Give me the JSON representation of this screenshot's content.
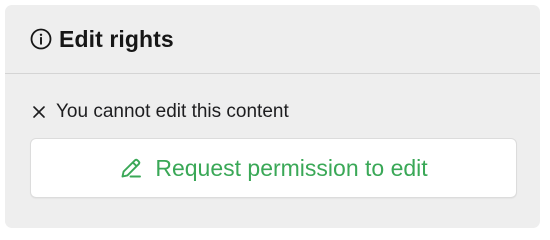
{
  "panel": {
    "icon": "info-icon",
    "title": "Edit rights"
  },
  "status": {
    "icon": "close-icon",
    "text": "You cannot edit this content"
  },
  "request_button": {
    "icon": "pencil-icon",
    "label": "Request permission to edit"
  },
  "colors": {
    "panel_background": "#eeeeee",
    "accent_green": "#3aa857",
    "divider": "#d4d4d4"
  }
}
